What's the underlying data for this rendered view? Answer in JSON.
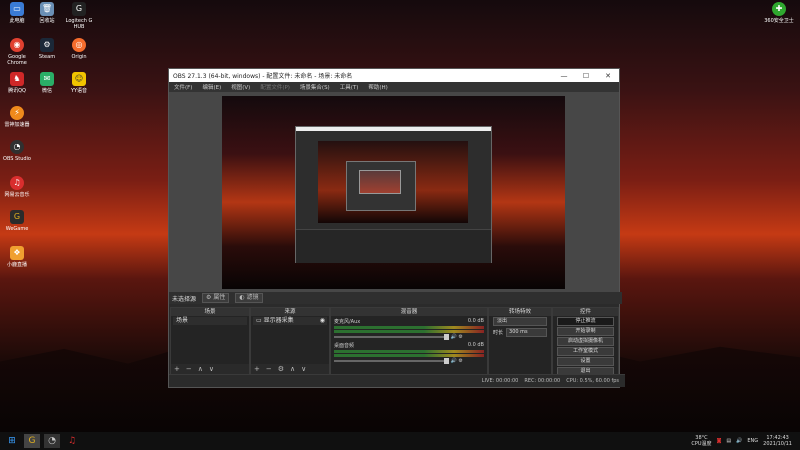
{
  "desktop": {
    "icons": [
      {
        "label": "此电脑",
        "icon": "computer-icon",
        "color": "#3a7bd5",
        "glyph": "▭"
      },
      {
        "label": "回收站",
        "icon": "recycle-bin-icon",
        "color": "#6a8fb5",
        "glyph": "🗑"
      },
      {
        "label": "Logitech G HUB",
        "icon": "logitech-icon",
        "color": "#222222",
        "glyph": "G"
      },
      {
        "label": "Google Chrome",
        "icon": "chrome-icon",
        "color": "#e04030",
        "glyph": "◉"
      },
      {
        "label": "Steam",
        "icon": "steam-icon",
        "color": "#1b2838",
        "glyph": "⚙"
      },
      {
        "label": "Origin",
        "icon": "origin-icon",
        "color": "#f56c2d",
        "glyph": "◎"
      },
      {
        "label": "腾讯QQ",
        "icon": "qq-icon",
        "color": "#d02828",
        "glyph": "♞"
      },
      {
        "label": "微信",
        "icon": "wechat-icon",
        "color": "#2aae67",
        "glyph": "✉"
      },
      {
        "label": "YY语音",
        "icon": "yy-icon",
        "color": "#f2c400",
        "glyph": "☺"
      },
      {
        "label": "雷神加速器",
        "icon": "leishen-icon",
        "color": "#f08a1c",
        "glyph": "⚡"
      },
      {
        "label": "OBS Studio",
        "icon": "obs-icon",
        "color": "#303030",
        "glyph": "◔"
      },
      {
        "label": "网易云音乐",
        "icon": "netease-music-icon",
        "color": "#d92e2e",
        "glyph": "♫"
      },
      {
        "label": "WeGame",
        "icon": "wegame-icon",
        "color": "#e0b020",
        "glyph": "G"
      },
      {
        "label": "小鹿直播",
        "icon": "xiaolu-icon",
        "color": "#f0a030",
        "glyph": "❖"
      },
      {
        "label": "360安全卫士",
        "icon": "360-security-icon",
        "color": "#2fa82f",
        "glyph": "✚"
      }
    ]
  },
  "obs": {
    "title": "OBS 27.1.3 (64-bit, windows) - 配置文件: 未命名 - 场景: 未命名",
    "menu": [
      "文件(F)",
      "编辑(E)",
      "视图(V)",
      "配置文件(P)",
      "场景集合(S)",
      "工具(T)",
      "帮助(H)"
    ],
    "scene_bar": {
      "label": "未选择源",
      "btn1": "属性",
      "btn2": "滤镜"
    },
    "docks": {
      "scenes": {
        "header": "场景",
        "items": [
          "场景"
        ]
      },
      "sources": {
        "header": "来源",
        "items": [
          "显示器采集"
        ]
      },
      "mixer": {
        "header": "混音器",
        "channels": [
          {
            "name": "麦克风/Aux",
            "db": "0.0 dB"
          },
          {
            "name": "桌面音频",
            "db": "0.0 dB"
          }
        ]
      },
      "transitions": {
        "header": "转场特效",
        "mode": "淡出",
        "duration_label": "时长",
        "duration": "300 ms"
      },
      "controls": {
        "header": "控件",
        "buttons": [
          "停止推流",
          "开始录制",
          "启动虚拟摄像机",
          "工作室模式",
          "设置",
          "退出"
        ]
      }
    },
    "status": {
      "live": "LIVE: 00:00:00",
      "rec": "REC: 00:00:00",
      "cpu": "CPU: 0.5%, 60.00 fps"
    }
  },
  "taskbar": {
    "tray": {
      "temp": "38°C",
      "temp_label": "CPU温度",
      "lang": "ENG",
      "time": "17:42:43",
      "date": "2021/10/11"
    }
  }
}
